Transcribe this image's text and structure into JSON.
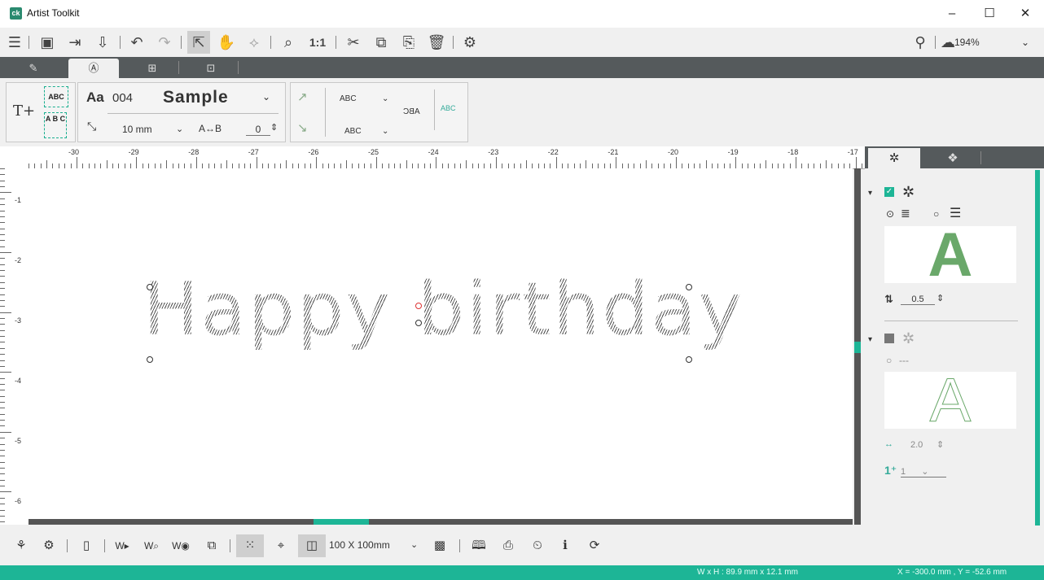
{
  "window": {
    "title": "Artist Toolkit",
    "minimize": "–",
    "maximize": "☐",
    "close": "✕"
  },
  "toolbar": {
    "zoom": "194%",
    "one_to_one": "1:1"
  },
  "ribbon": {
    "text_icon": "T+",
    "abc_horizontal": "ABC",
    "abc_vertical": "A B C",
    "font_prefix": "Aa",
    "font_number": "004",
    "font_name": "Sample",
    "size_value": "10 mm",
    "spacing_value": "0",
    "abc_upper": "ABC",
    "abc_lower": "ABC",
    "abc_mirror": "ABC",
    "abc_arc": "ABC"
  },
  "ruler": {
    "h_labels": [
      "-30",
      "-29",
      "-28",
      "-27",
      "-26",
      "-25",
      "-24",
      "-23",
      "-22",
      "-21",
      "-20",
      "-19",
      "-18",
      "-17"
    ],
    "v_labels": [
      "-1",
      "-2",
      "-3",
      "-4",
      "-5",
      "-6"
    ]
  },
  "canvas": {
    "text": "Happy birthday"
  },
  "right_panel": {
    "fill_density": "0.5",
    "outline_value": "2.0",
    "count_value": "1",
    "dashes": "---",
    "preview_letter": "A"
  },
  "bottom": {
    "hoop_size": "100 X 100mm"
  },
  "status": {
    "dimensions": "W x H : 89.9 mm x 12.1 mm",
    "coordinates": "X = -300.0 mm , Y = -52.6 mm"
  }
}
